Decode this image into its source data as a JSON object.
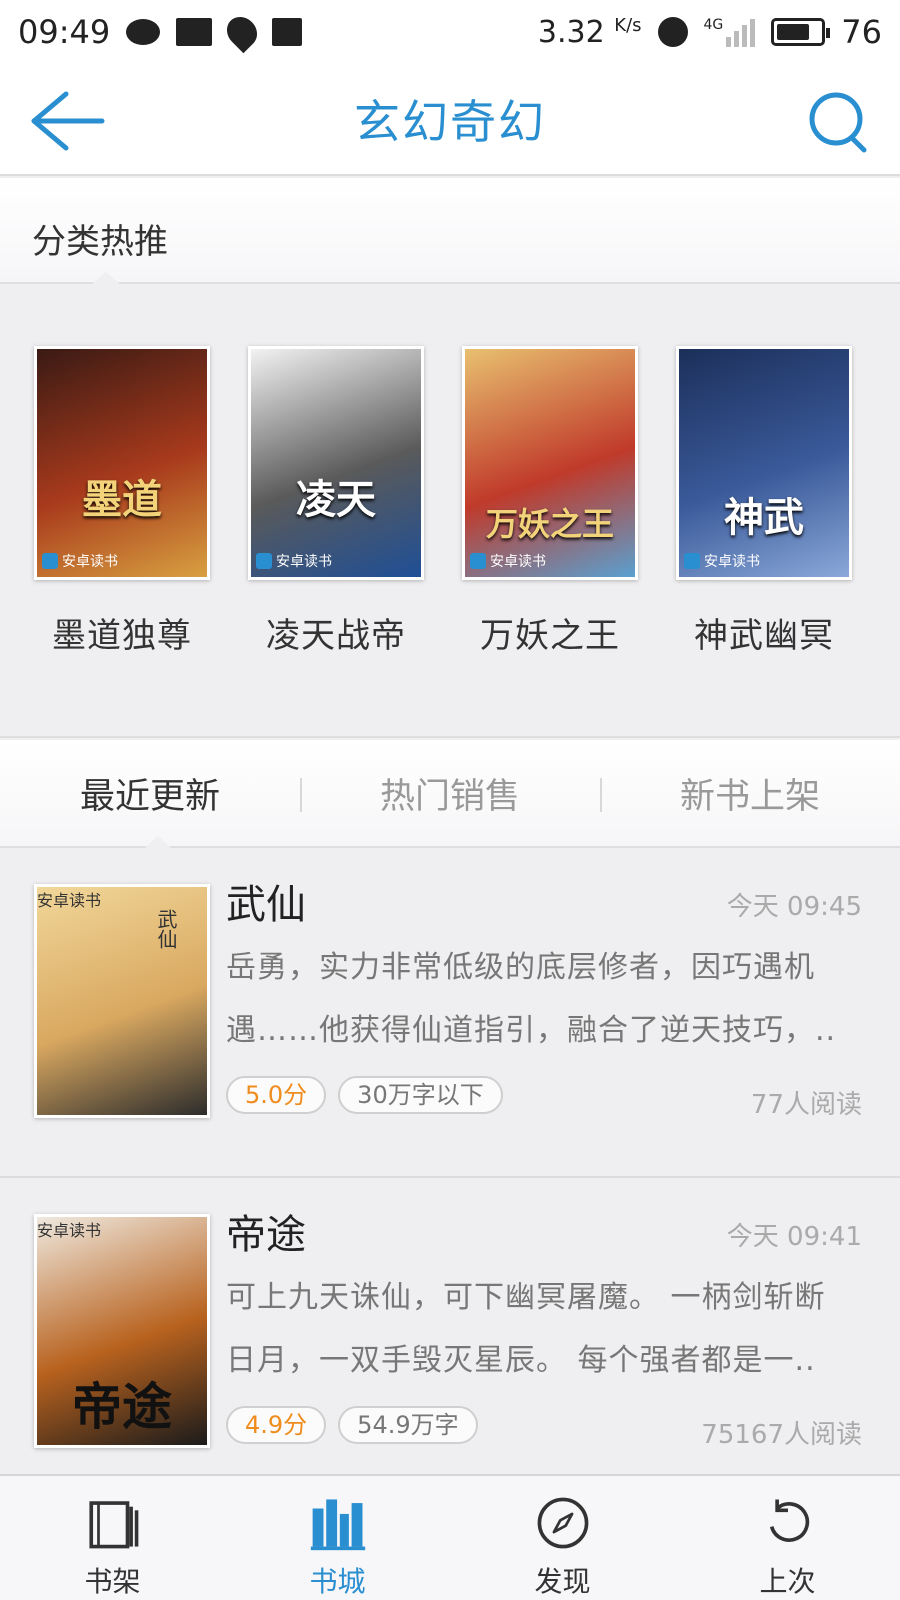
{
  "status_bar": {
    "time": "09:49",
    "network_speed": "3.32",
    "network_unit": "K/s",
    "network_type": "4G",
    "battery": "76",
    "battery_level": 0.76
  },
  "header": {
    "title": "玄幻奇幻"
  },
  "hot": {
    "label": "分类热推",
    "items": [
      {
        "name": "墨道独尊",
        "cover_title": "墨道",
        "cover_brand": "安卓读书",
        "colors": [
          "#3a1a14",
          "#a83a1c",
          "#d8a040"
        ]
      },
      {
        "name": "凌天战帝",
        "cover_title": "凌天",
        "cover_brand": "安卓读书",
        "colors": [
          "#f2f2f2",
          "#5a5a5a",
          "#1f4f96"
        ]
      },
      {
        "name": "万妖之王",
        "cover_title": "万妖之王",
        "cover_brand": "安卓读书",
        "colors": [
          "#e8c070",
          "#c03a2a",
          "#5aa0d0"
        ]
      },
      {
        "name": "神武幽冥",
        "cover_title": "神武",
        "cover_brand": "安卓读书",
        "colors": [
          "#1c2f5a",
          "#3a5a9a",
          "#8aa8d8"
        ]
      }
    ]
  },
  "tabs": [
    {
      "label": "最近更新",
      "active": true
    },
    {
      "label": "热门销售",
      "active": false
    },
    {
      "label": "新书上架",
      "active": false
    }
  ],
  "books": [
    {
      "title": "武仙",
      "time": "今天 09:45",
      "desc_line1": "岳勇，实力非常低级的底层修者，因巧遇机",
      "desc_line2": "遇……他获得仙道指引，融合了逆天技巧，..",
      "score": "5.0分",
      "length": "30万字以下",
      "readers": "77人阅读",
      "cover_title": "武仙",
      "cover_brand": "安卓读书",
      "colors": [
        "#f1d79a",
        "#d9a860",
        "#2c2c2c"
      ]
    },
    {
      "title": "帝途",
      "time": "今天 09:41",
      "desc_line1": "可上九天诛仙，可下幽冥屠魔。 一柄剑斩断",
      "desc_line2": "日月，一双手毁灭星辰。 每个强者都是一..",
      "score": "4.9分",
      "length": "54.9万字",
      "readers": "75167人阅读",
      "cover_title": "帝途",
      "cover_brand": "安卓读书",
      "colors": [
        "#efe9df",
        "#b8621e",
        "#1b1b1b"
      ]
    }
  ],
  "bottom_nav": [
    {
      "label": "书架",
      "icon": "bookshelf-icon",
      "active": false
    },
    {
      "label": "书城",
      "icon": "bookstore-icon",
      "active": true
    },
    {
      "label": "发现",
      "icon": "compass-icon",
      "active": false
    },
    {
      "label": "上次",
      "icon": "last-read-icon",
      "active": false
    }
  ],
  "colors": {
    "accent": "#2a8fd0",
    "score": "#f08c1e"
  }
}
